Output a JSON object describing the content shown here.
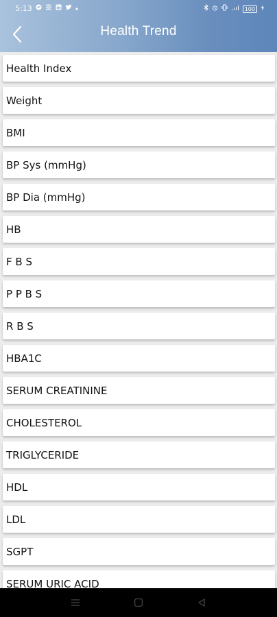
{
  "status_bar": {
    "time": "5:13",
    "left_icons": [
      "messenger-icon",
      "message-icon",
      "linkedin-icon",
      "twitter-icon",
      "dot-icon"
    ],
    "right_icons": [
      "bluetooth-icon",
      "alarm-icon",
      "vibrate-icon",
      "signal-icon",
      "battery-icon"
    ],
    "battery_level": "100"
  },
  "header": {
    "title": "Health Trend",
    "back_icon": "chevron-left-icon"
  },
  "colors": {
    "header_gradient_start": "#a9c2dd",
    "header_gradient_end": "#5d86ba",
    "list_background": "#ececec",
    "card_background": "#ffffff",
    "nav_bar": "#000000"
  },
  "list": {
    "items": [
      {
        "label": "Health Index"
      },
      {
        "label": "Weight"
      },
      {
        "label": "BMI"
      },
      {
        "label": "BP Sys (mmHg)"
      },
      {
        "label": "BP Dia (mmHg)"
      },
      {
        "label": "HB"
      },
      {
        "label": "F B S"
      },
      {
        "label": "P P B S"
      },
      {
        "label": "R B S"
      },
      {
        "label": "HBA1C"
      },
      {
        "label": "SERUM CREATININE"
      },
      {
        "label": "CHOLESTEROL"
      },
      {
        "label": "TRIGLYCERIDE"
      },
      {
        "label": "HDL"
      },
      {
        "label": "LDL"
      },
      {
        "label": "SGPT"
      },
      {
        "label": "SERUM URIC ACID"
      }
    ]
  },
  "nav_bar": {
    "buttons": [
      "menu-icon",
      "home-icon",
      "back-triangle-icon"
    ]
  }
}
